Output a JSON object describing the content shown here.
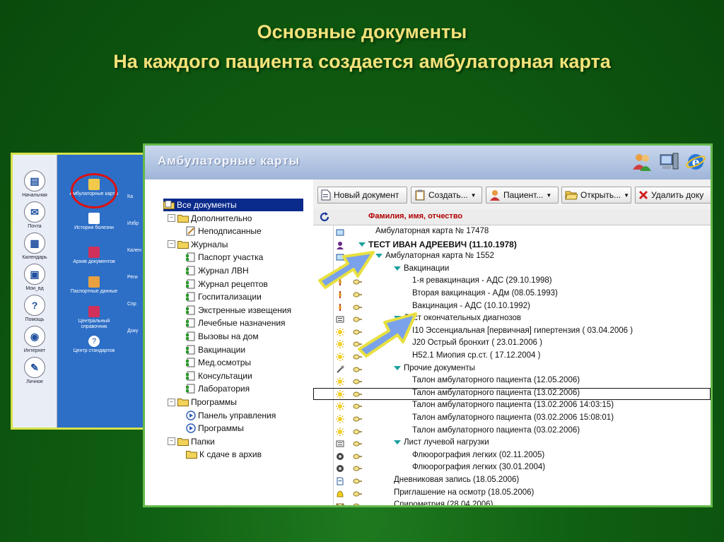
{
  "slide": {
    "title_line1": "Основные документы",
    "title_line2": "На каждого пациента создается амбулаторная карта",
    "title_color": "#f4e27a",
    "background_color": "#0f5e12"
  },
  "back_window": {
    "left_items": [
      {
        "label": "Начальная",
        "icon": "home-icon"
      },
      {
        "label": "Почта",
        "icon": "mail-icon"
      },
      {
        "label": "Календарь",
        "icon": "calendar-icon"
      },
      {
        "label": "Мои_вд",
        "icon": "documents-icon"
      },
      {
        "label": "Помощь",
        "icon": "help-icon"
      },
      {
        "label": "Интернет",
        "icon": "internet-icon"
      },
      {
        "label": "Личное",
        "icon": "personal-icon"
      }
    ],
    "column_items": [
      {
        "label": "Амбулаторные карты",
        "icon": "folder-icon"
      },
      {
        "label": "Истории болезни",
        "icon": "page-icon"
      },
      {
        "label": "Архив документов",
        "icon": "book-icon"
      },
      {
        "label": "Паспортные данные",
        "icon": "people-icon"
      },
      {
        "label": "Центральный справочник",
        "icon": "book-icon"
      },
      {
        "label": "Центр стандартов",
        "icon": "help-icon"
      }
    ],
    "clipped_items": [
      "Ка",
      "Избр",
      "Кален",
      "Реги",
      "Спр",
      "Доку"
    ]
  },
  "window": {
    "title": "Амбулаторные карты",
    "header_icons": [
      "users-icon",
      "computer-icon",
      "browser-icon"
    ]
  },
  "tree": {
    "items": [
      {
        "label": "Все документы",
        "level": 0,
        "type": "folder-open",
        "selected": true
      },
      {
        "label": "Дополнительно",
        "level": 0,
        "type": "folder",
        "expander": "−"
      },
      {
        "label": "Неподписанные",
        "level": 1,
        "type": "pen"
      },
      {
        "label": "Журналы",
        "level": 0,
        "type": "folder",
        "expander": "−"
      },
      {
        "label": "Паспорт участка",
        "level": 1,
        "type": "journal"
      },
      {
        "label": "Журнал ЛВН",
        "level": 1,
        "type": "journal"
      },
      {
        "label": "Журнал рецептов",
        "level": 1,
        "type": "journal"
      },
      {
        "label": "Госпитализации",
        "level": 1,
        "type": "journal"
      },
      {
        "label": "Экстренные извещения",
        "level": 1,
        "type": "journal"
      },
      {
        "label": "Лечебные назначения",
        "level": 1,
        "type": "journal"
      },
      {
        "label": "Вызовы на дом",
        "level": 1,
        "type": "journal"
      },
      {
        "label": "Вакцинации",
        "level": 1,
        "type": "journal"
      },
      {
        "label": "Мед.осмотры",
        "level": 1,
        "type": "journal"
      },
      {
        "label": "Консультации",
        "level": 1,
        "type": "journal"
      },
      {
        "label": "Лаборатория",
        "level": 1,
        "type": "journal"
      },
      {
        "label": "Программы",
        "level": 0,
        "type": "folder",
        "expander": "−"
      },
      {
        "label": "Панель управления",
        "level": 1,
        "type": "program"
      },
      {
        "label": "Программы",
        "level": 1,
        "type": "program"
      },
      {
        "label": "Папки",
        "level": 0,
        "type": "folder",
        "expander": "−"
      },
      {
        "label": "К сдаче в архив",
        "level": 1,
        "type": "folder"
      }
    ]
  },
  "toolbar": {
    "new_document": "Новый документ",
    "create": "Создать...",
    "patient": "Пациент...",
    "open": "Открыть...",
    "delete": "Удалить доку"
  },
  "grid": {
    "column_header": "Фамилия, имя, отчество",
    "rows": [
      {
        "text": "Амбулаторная карта № 17478",
        "indent": 1,
        "ic1": "card",
        "ic2": false
      },
      {
        "text": "ТЕСТ ИВАН АДРЕЕВИЧ (11.10.1978)",
        "indent": 0,
        "ic1": "person",
        "ic2": false,
        "tri": true,
        "bold": true
      },
      {
        "text": "Амбулаторная карта № 1552",
        "indent": 1,
        "ic1": "card",
        "ic2": false,
        "tri": true
      },
      {
        "text": "Вакцинации",
        "indent": 2,
        "ic1": "syringe",
        "ic2": true,
        "tri": true
      },
      {
        "text": "1-я ревакцинация - АДС (29.10.1998)",
        "indent": 3,
        "ic1": "syringe",
        "ic2": true
      },
      {
        "text": "Вторая вакцинация - АДм (08.05.1993)",
        "indent": 3,
        "ic1": "syringe",
        "ic2": true
      },
      {
        "text": "Вакцинация - АДС (10.10.1992)",
        "indent": 3,
        "ic1": "syringe",
        "ic2": true
      },
      {
        "text": "Лист окончательных диагнозов",
        "indent": 2,
        "ic1": "list",
        "ic2": true,
        "tri": true
      },
      {
        "text": "I10 Эссенциальная [первичная] гипертензия  ( 03.04.2006 )",
        "indent": 3,
        "ic1": "sun",
        "ic2": true
      },
      {
        "text": "J20 Острый бронхит  ( 23.01.2006 )",
        "indent": 3,
        "ic1": "sun",
        "ic2": true
      },
      {
        "text": "H52.1 Миопия ср.ст.  ( 17.12.2004 )",
        "indent": 3,
        "ic1": "sun",
        "ic2": true
      },
      {
        "text": "Прочие документы",
        "indent": 2,
        "ic1": "tools",
        "ic2": true,
        "tri": true
      },
      {
        "text": "Талон амбулаторного пациента (12.05.2006)",
        "indent": 3,
        "ic1": "sun",
        "ic2": true
      },
      {
        "text": "Талон амбулаторного пациента  (13.02.2006)",
        "indent": 3,
        "ic1": "sun",
        "ic2": true,
        "boxed": true
      },
      {
        "text": "Талон амбулаторного пациента (13.02.2006 14:03:15)",
        "indent": 3,
        "ic1": "sun",
        "ic2": true
      },
      {
        "text": "Талон амбулаторного пациента (03.02.2006 15:08:01)",
        "indent": 3,
        "ic1": "sun",
        "ic2": true
      },
      {
        "text": "Талон амбулаторного пациента  (03.02.2006)",
        "indent": 3,
        "ic1": "sun",
        "ic2": true
      },
      {
        "text": "Лист лучевой нагрузки",
        "indent": 2,
        "ic1": "list",
        "ic2": true,
        "tri": true
      },
      {
        "text": "Флюорография легких (02.11.2005)",
        "indent": 3,
        "ic1": "xray",
        "ic2": true
      },
      {
        "text": "Флюорография легких (30.01.2004)",
        "indent": 3,
        "ic1": "xray",
        "ic2": true
      },
      {
        "text": "Дневниковая запись (18.05.2006)",
        "indent": 2,
        "ic1": "page",
        "ic2": true
      },
      {
        "text": "Приглашение на  осмотр  (18.05.2006)",
        "indent": 2,
        "ic1": "bell",
        "ic2": true
      },
      {
        "text": "Спирометрия (28.04.2006)",
        "indent": 2,
        "ic1": "mail",
        "ic2": true
      }
    ]
  }
}
